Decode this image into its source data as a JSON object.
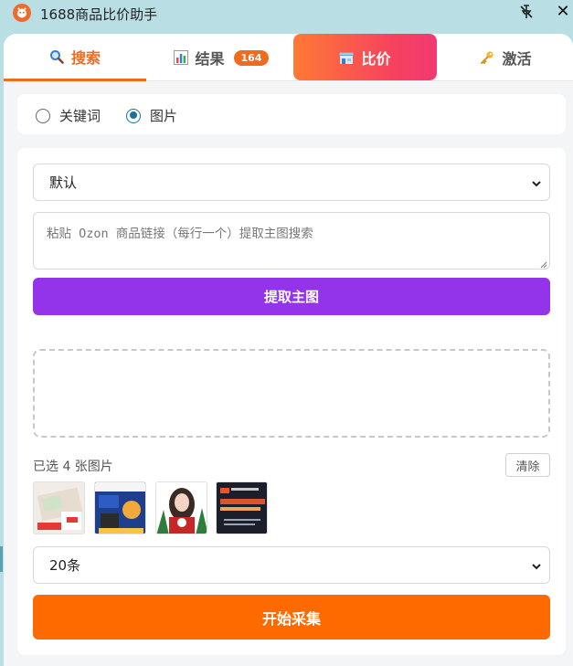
{
  "window": {
    "title": "1688商品比价助手",
    "close_glyph": "✕"
  },
  "tabs": [
    {
      "label": "搜索",
      "icon": "search-icon",
      "active": true
    },
    {
      "label": "结果",
      "icon": "bar-chart-icon",
      "badge": "164"
    },
    {
      "label": "比价",
      "icon": "store-icon",
      "highlighted": true
    },
    {
      "label": "激活",
      "icon": "key-icon"
    }
  ],
  "search_mode": {
    "options": [
      {
        "label": "关键词",
        "checked": false
      },
      {
        "label": "图片",
        "checked": true
      }
    ]
  },
  "form": {
    "sort_select": {
      "value": "默认"
    },
    "link_input": {
      "placeholder": "粘贴 Ozon 商品链接（每行一个）提取主图搜索"
    },
    "extract_button": "提取主图",
    "selected_text": "已选 4 张图片",
    "clear_button": "清除",
    "count_select": {
      "value": "20条"
    },
    "start_button": "开始采集"
  },
  "colors": {
    "accent_orange": "#f26b1d",
    "extract_purple": "#9333ea",
    "start_orange": "#ff6a00",
    "compare_gradient_start": "#ff7a33",
    "compare_gradient_end": "#f23a73",
    "radio_checked": "#1f6f9c"
  }
}
